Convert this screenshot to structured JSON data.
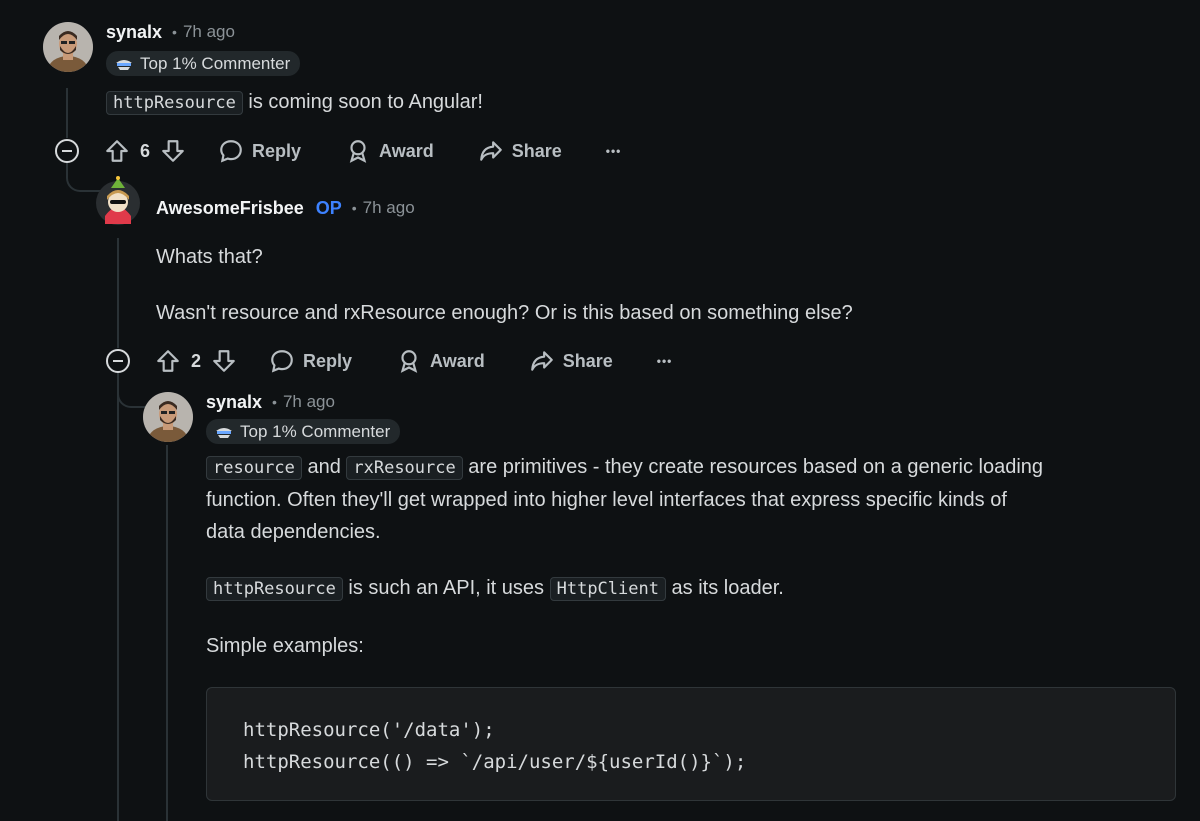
{
  "comment1": {
    "username": "synalx",
    "time": "7h ago",
    "flair": "Top 1% Commenter",
    "body_code": "httpResource",
    "body_text": " is coming soon to Angular!",
    "score": "6",
    "reply": "Reply",
    "award": "Award",
    "share": "Share",
    "more": "•••"
  },
  "comment2": {
    "username": "AwesomeFrisbee",
    "op_badge": "OP",
    "time": "7h ago",
    "para1": "Whats that?",
    "para2": "Wasn't resource and rxResource enough? Or is this based on something else?",
    "score": "2",
    "reply": "Reply",
    "award": "Award",
    "share": "Share",
    "more": "•••"
  },
  "comment3": {
    "username": "synalx",
    "time": "7h ago",
    "flair": "Top 1% Commenter",
    "p1_code1": "resource",
    "p1_and": " and ",
    "p1_code2": "rxResource",
    "p1_rest1": " are primitives - they create resources based on a generic loading",
    "p1_line2": "function. Often they'll get wrapped into higher level interfaces that express specific kinds of",
    "p1_line3": "data dependencies.",
    "p2_code1": "httpResource",
    "p2_text1": " is such an API, it uses ",
    "p2_code2": "HttpClient",
    "p2_text2": " as its loader.",
    "p3": "Simple examples:",
    "code_lines": [
      "httpResource('/data');",
      "httpResource(() => `/api/user/${userId()}`);"
    ]
  },
  "colors": {
    "background": "#0e1113",
    "op": "#3d82ff",
    "text": "#d7dadc",
    "muted": "#8b9297"
  },
  "icons": [
    "upvote-icon",
    "downvote-icon",
    "comment-icon",
    "award-icon",
    "share-icon",
    "collapse-icon",
    "flair-icon"
  ]
}
